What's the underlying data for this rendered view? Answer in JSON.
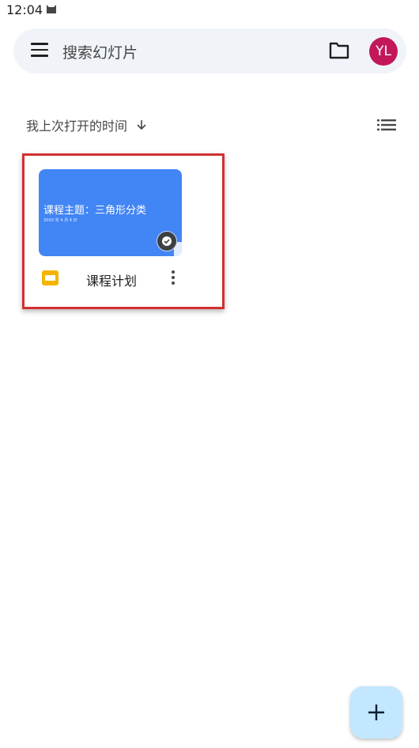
{
  "status_bar": {
    "time": "12:04"
  },
  "search": {
    "placeholder": "搜索幻灯片",
    "avatar_initials": "YL",
    "avatar_color": "#c2185b"
  },
  "sort": {
    "label": "我上次打开的时间"
  },
  "files": [
    {
      "name": "课程计划",
      "thumbnail_title": "课程主题：三角形分类",
      "thumbnail_subtitle": "20XX 年 4 月 4 日",
      "thumbnail_color": "#4285f4",
      "type_icon": "slides-icon",
      "offline": true
    }
  ],
  "colors": {
    "accent": "#4285f4",
    "highlight": "#d32f2f",
    "fab": "#c2e7ff"
  }
}
